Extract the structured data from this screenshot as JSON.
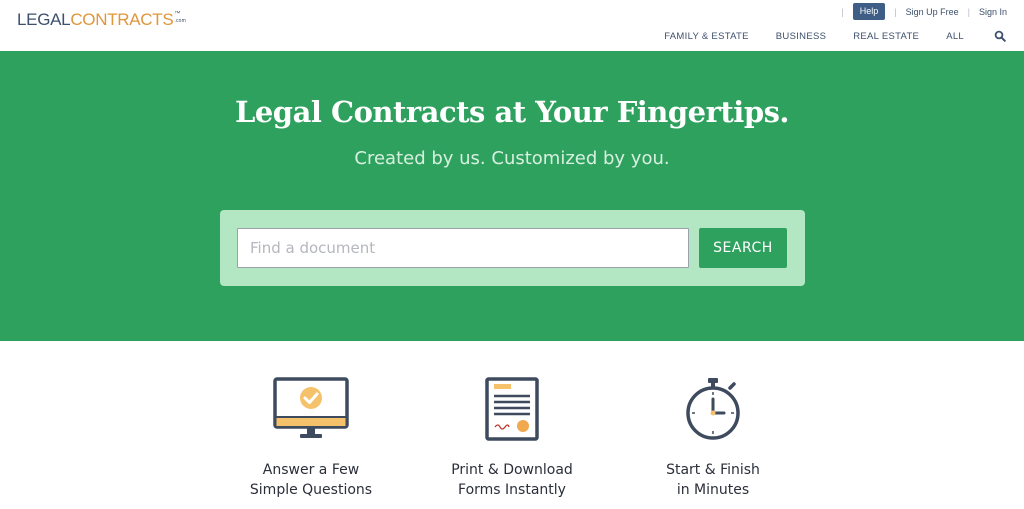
{
  "header": {
    "logo": {
      "part1": "LEGAL",
      "part2": "CONTRACTS",
      "tm": "™",
      "com": ".com"
    },
    "util_nav": {
      "help": "Help",
      "signup": "Sign Up Free",
      "signin": "Sign In",
      "separator": "|"
    },
    "main_nav": [
      "FAMILY & ESTATE",
      "BUSINESS",
      "REAL ESTATE",
      "ALL"
    ],
    "search_icon": "search-icon"
  },
  "hero": {
    "title": "Legal Contracts at Your Fingertips.",
    "subtitle": "Created by us. Customized by you.",
    "search": {
      "placeholder": "Find a document",
      "value": "",
      "button": "SEARCH"
    }
  },
  "features": [
    {
      "icon": "monitor-check-icon",
      "line1": "Answer a Few",
      "line2": "Simple Questions"
    },
    {
      "icon": "document-icon",
      "line1": "Print & Download",
      "line2": "Forms Instantly"
    },
    {
      "icon": "stopwatch-icon",
      "line1": "Start & Finish",
      "line2": "in Minutes"
    }
  ],
  "colors": {
    "brand_green": "#2fa15e",
    "search_panel": "#b3e6c2",
    "navy": "#3e506c",
    "help_button": "#3e5e86",
    "accent_orange": "#e0963a",
    "icon_yellow": "#f5c26b"
  }
}
